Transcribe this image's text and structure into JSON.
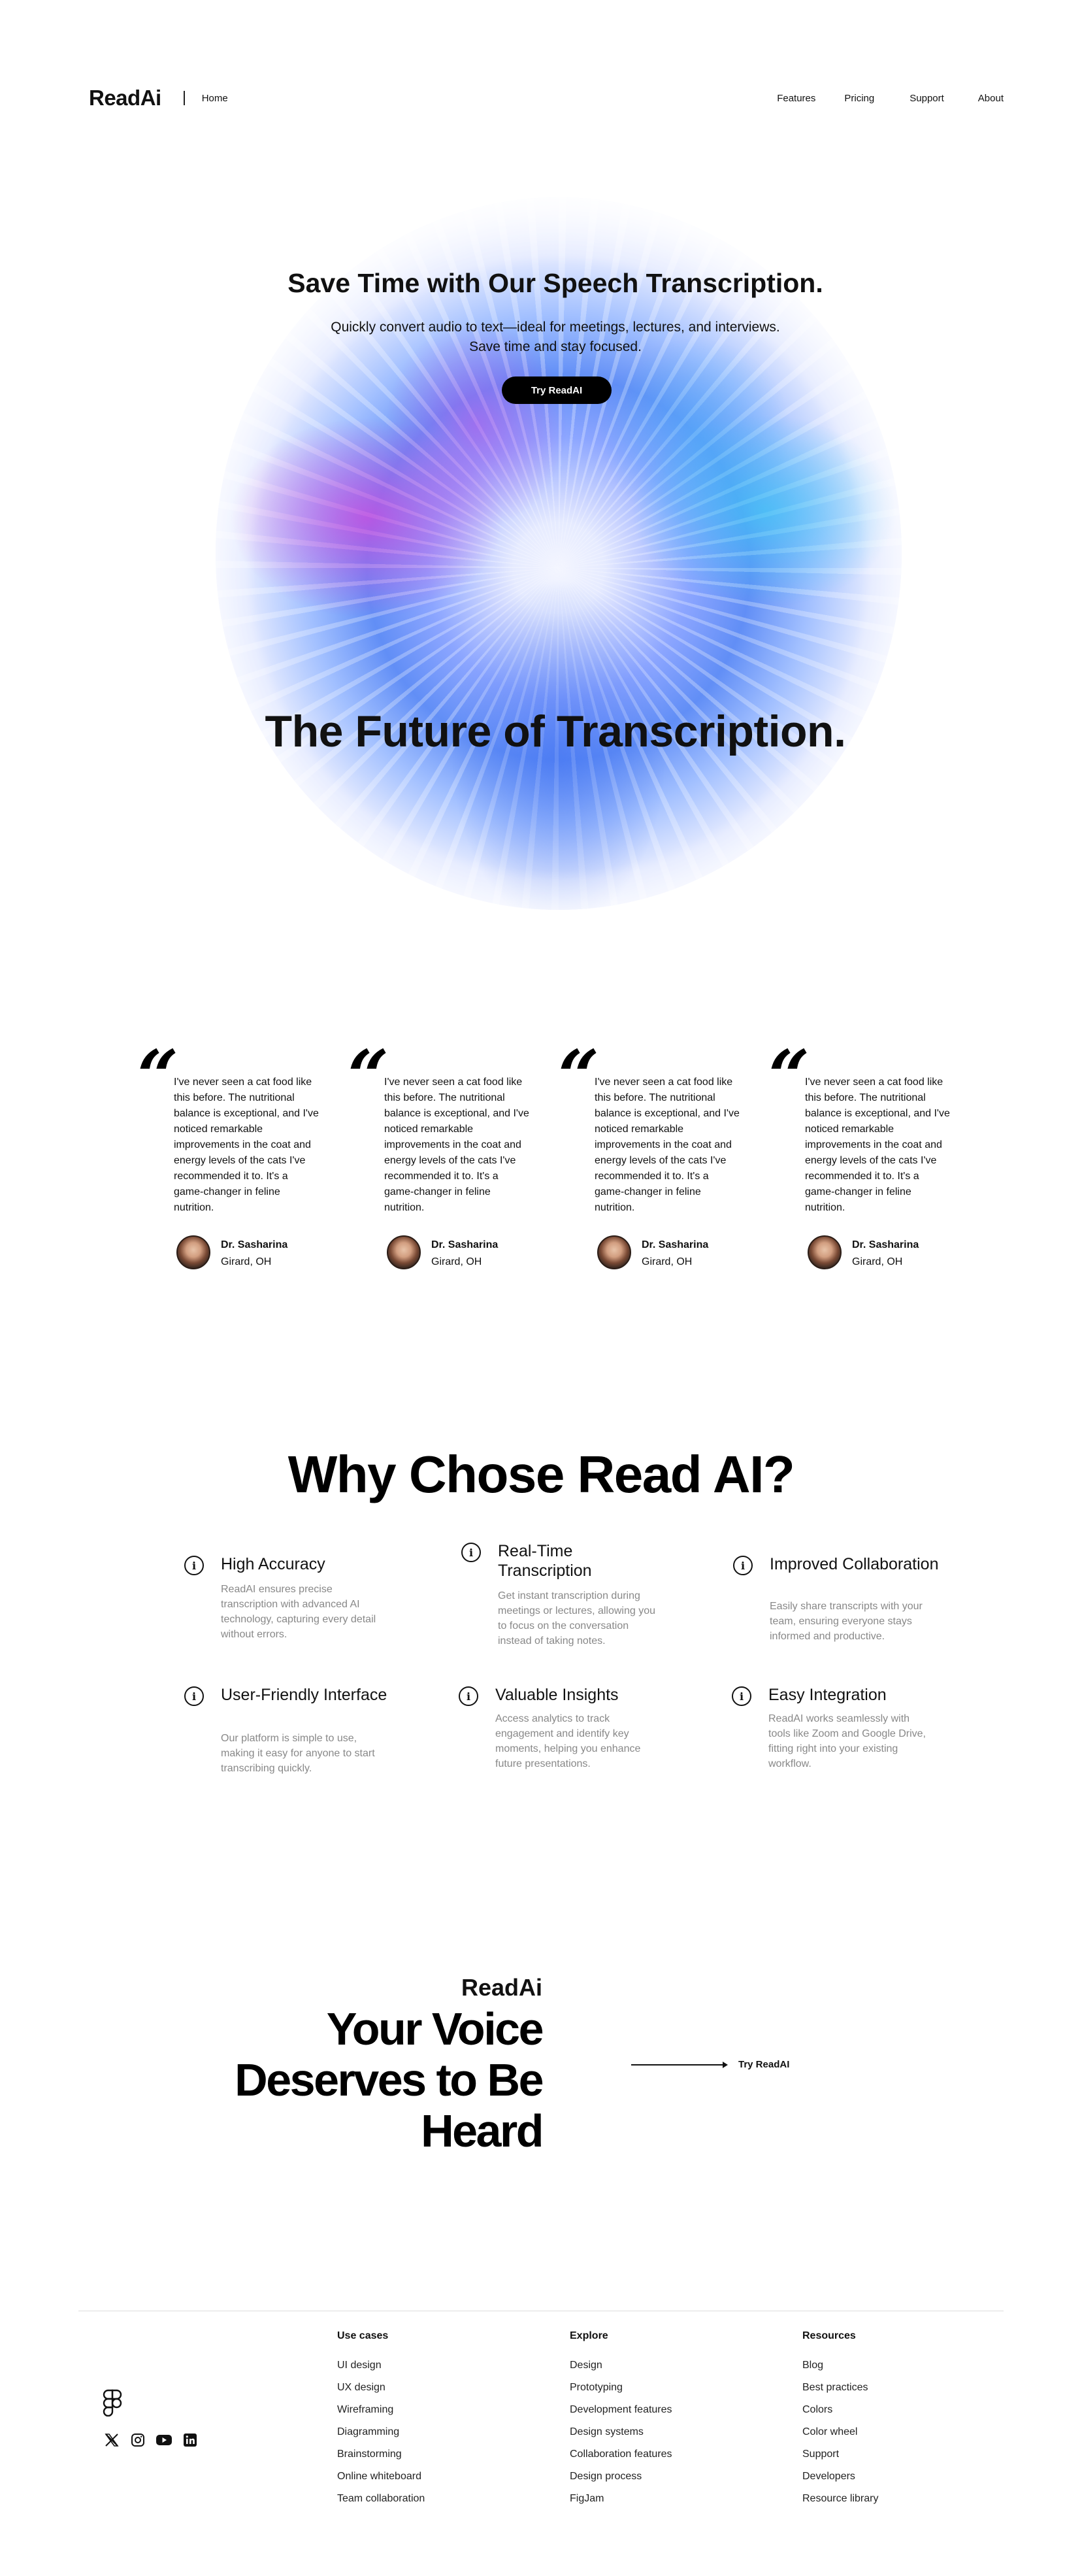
{
  "nav": {
    "logo": "ReadAi",
    "home": "Home",
    "links": [
      "Features",
      "Pricing",
      "Support",
      "About"
    ]
  },
  "hero": {
    "title": "Save Time with Our Speech Transcription.",
    "subtitle_line1": "Quickly convert audio to text—ideal for meetings, lectures, and interviews.",
    "subtitle_line2": "Save time and stay focused.",
    "button": "Try ReadAI",
    "big_heading": "The Future of Transcription."
  },
  "testimonials": [
    {
      "quote": "I've never seen a cat food like this before. The nutritional balance is exceptional, and I've noticed remarkable improvements in the coat and energy levels of the cats I've recommended it to. It's a game-changer in feline nutrition.",
      "name": "Dr. Sasharina",
      "location": "Girard, OH"
    },
    {
      "quote": "I've never seen a cat food like this before. The nutritional balance is exceptional, and I've noticed remarkable improvements in the coat and energy levels of the cats I've recommended it to. It's a game-changer in feline nutrition.",
      "name": "Dr. Sasharina",
      "location": "Girard, OH"
    },
    {
      "quote": "I've never seen a cat food like this before. The nutritional balance is exceptional, and I've noticed remarkable improvements in the coat and energy levels of the cats I've recommended it to. It's a game-changer in feline nutrition.",
      "name": "Dr. Sasharina",
      "location": "Girard, OH"
    },
    {
      "quote": "I've never seen a cat food like this before. The nutritional balance is exceptional, and I've noticed remarkable improvements in the coat and energy levels of the cats I've recommended it to. It's a game-changer in feline nutrition.",
      "name": "Dr. Sasharina",
      "location": "Girard, OH"
    }
  ],
  "why": {
    "title": "Why Chose Read AI?",
    "features": [
      {
        "title": "High Accuracy",
        "desc": "ReadAI ensures precise transcription with advanced AI technology, capturing every detail without errors."
      },
      {
        "title": "Real-Time Transcription",
        "desc": "Get instant transcription during meetings or lectures, allowing you to focus on the conversation instead of taking notes."
      },
      {
        "title": "Improved Collaboration",
        "desc": "Easily share transcripts with your team, ensuring everyone stays informed and productive."
      },
      {
        "title": "User-Friendly Interface",
        "desc": "Our platform is simple to use, making it easy for anyone to start transcribing quickly."
      },
      {
        "title": "Valuable Insights",
        "desc": "Access analytics to track engagement and identify key moments, helping you enhance future presentations."
      },
      {
        "title": "Easy Integration",
        "desc": "ReadAI works seamlessly with tools like Zoom and Google Drive, fitting right into your existing workflow."
      }
    ]
  },
  "cta": {
    "brand": "ReadAi",
    "heading_line1": "Your Voice",
    "heading_line2": "Deserves to Be",
    "heading_line3": "Heard",
    "link": "Try ReadAI"
  },
  "footer": {
    "columns": [
      {
        "title": "Use cases",
        "items": [
          "UI design",
          "UX design",
          "Wireframing",
          "Diagramming",
          "Brainstorming",
          "Online whiteboard",
          "Team collaboration"
        ]
      },
      {
        "title": "Explore",
        "items": [
          "Design",
          "Prototyping",
          "Development features",
          "Design systems",
          "Collaboration features",
          "Design process",
          "FigJam"
        ]
      },
      {
        "title": "Resources",
        "items": [
          "Blog",
          "Best practices",
          "Colors",
          "Color wheel",
          "Support",
          "Developers",
          "Resource library"
        ]
      }
    ],
    "socials": [
      "x-icon",
      "instagram-icon",
      "youtube-icon",
      "linkedin-icon"
    ]
  }
}
